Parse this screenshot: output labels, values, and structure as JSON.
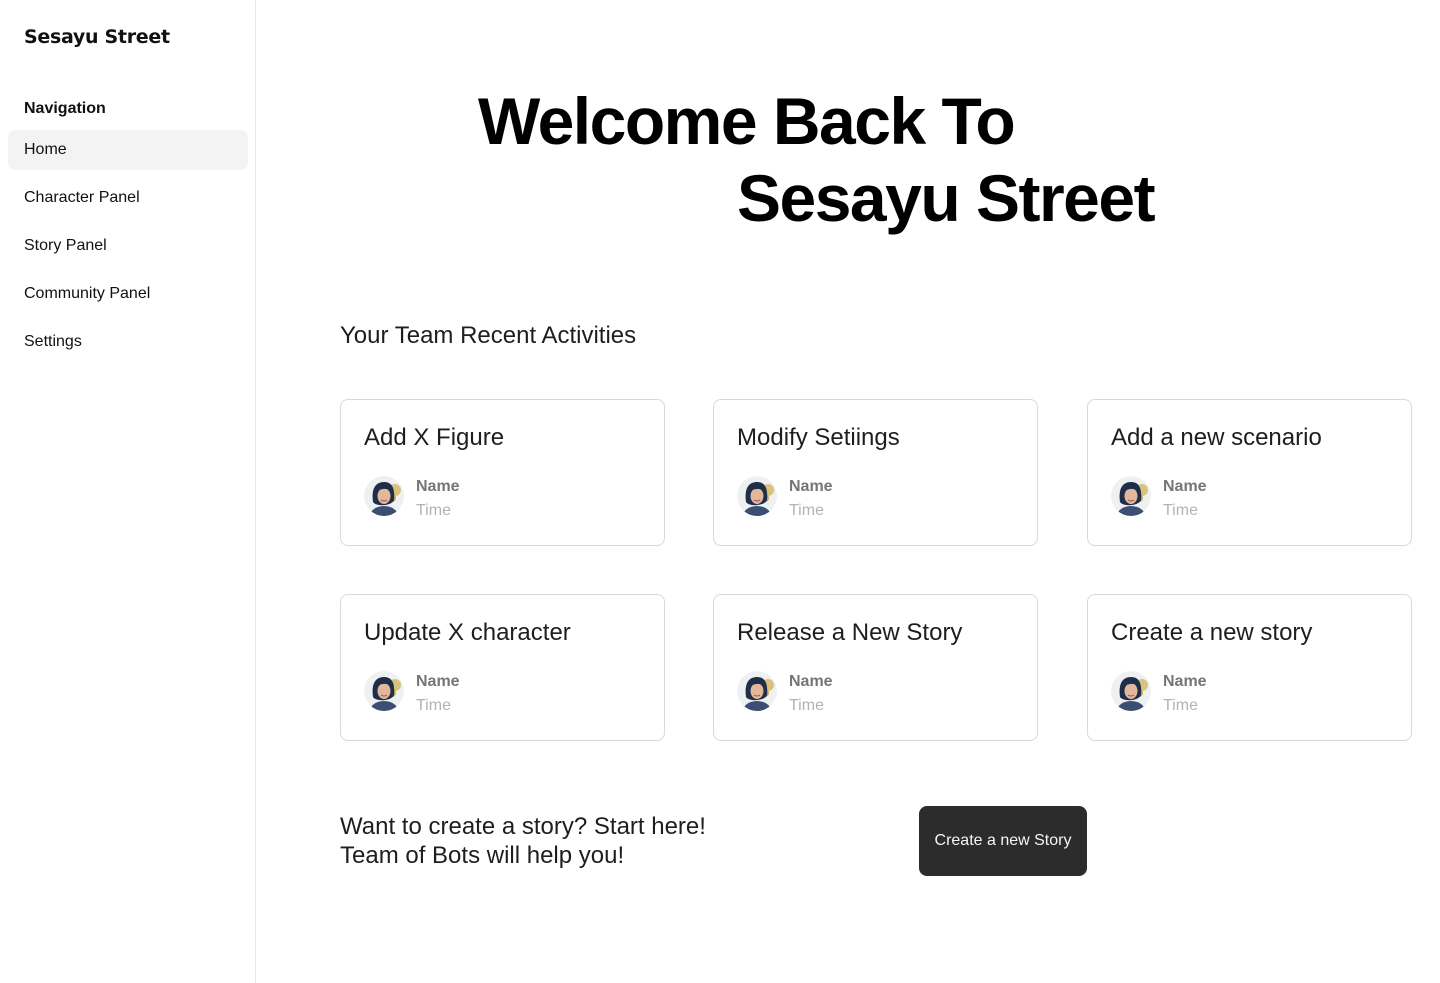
{
  "sidebar": {
    "brand": "Sesayu Street",
    "heading": "Navigation",
    "items": [
      {
        "label": "Home",
        "active": true
      },
      {
        "label": "Character Panel",
        "active": false
      },
      {
        "label": "Story Panel",
        "active": false
      },
      {
        "label": "Community Panel",
        "active": false
      },
      {
        "label": "Settings",
        "active": false
      }
    ]
  },
  "hero": {
    "line1": "Welcome Back To",
    "line2": "Sesayu Street"
  },
  "activities": {
    "title": "Your Team Recent Activities",
    "cards": [
      {
        "title": "Add X Figure",
        "name": "Name",
        "time": "Time"
      },
      {
        "title": "Modify Setiings",
        "name": "Name",
        "time": "Time"
      },
      {
        "title": "Add a new scenario",
        "name": "Name",
        "time": "Time"
      },
      {
        "title": "Update X character",
        "name": "Name",
        "time": "Time"
      },
      {
        "title": "Release a New Story",
        "name": "Name",
        "time": "Time"
      },
      {
        "title": "Create a new story",
        "name": "Name",
        "time": "Time"
      }
    ]
  },
  "cta": {
    "line1": "Want to create a story? Start here!",
    "line2": "Team of Bots will help you!",
    "button_label": "Create a new Story"
  },
  "colors": {
    "button_bg": "#2c2c2c",
    "active_nav_bg": "#f3f3f3",
    "card_border": "#d9d9d9"
  }
}
